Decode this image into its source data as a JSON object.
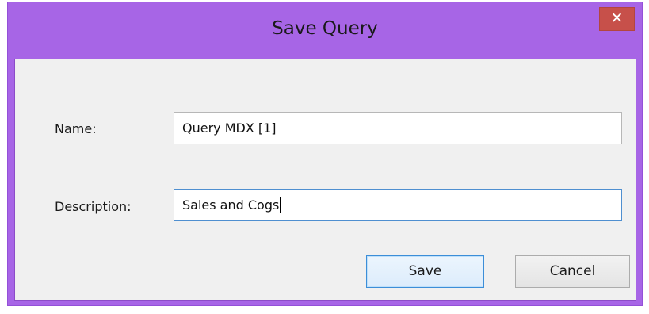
{
  "dialog": {
    "title": "Save Query",
    "close_glyph": "✕",
    "close_icon": "close-icon"
  },
  "form": {
    "name_label": "Name:",
    "name_value": "Query MDX [1]",
    "description_label": "Description:",
    "description_value": "Sales and Cogs"
  },
  "buttons": {
    "save_label": "Save",
    "cancel_label": "Cancel"
  },
  "colors": {
    "titlebar": "#a765e6",
    "close_button": "#c7504a",
    "client_area": "#f0f0f0",
    "focus_border": "#4f8fd0"
  }
}
